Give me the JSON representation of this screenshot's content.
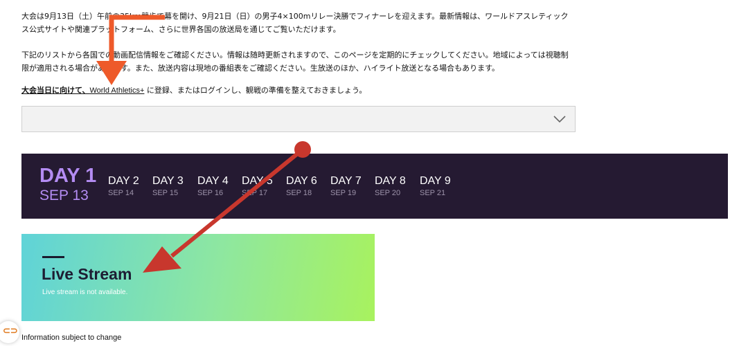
{
  "intro": {
    "p1": "大会は9月13日（土）午前の35km競歩で幕を開け、9月21日（日）の男子4×100mリレー決勝でフィナーレを迎えます。最新情報は、ワールドアスレティックス公式サイトや関連プラットフォーム、さらに世界各国の放送局を通じてご覧いただけます。",
    "p2": "下記のリストから各国での動画配信情報をご確認ください。情報は随時更新されますので、このページを定期的にチェックしてください。地域によっては視聴制限が適用される場合があります。また、放送内容は現地の番組表をご確認ください。生放送のほか、ハイライト放送となる場合もあります。",
    "p3_bold": "大会当日に向けて、",
    "p3_link": "World Athletics+",
    "p3_rest": " に登録、またはログインし、観戦の準備を整えておきましょう。"
  },
  "country_select": {
    "value": ""
  },
  "days": {
    "active": {
      "label": "DAY 1",
      "date": "SEP 13"
    },
    "items": [
      {
        "label": "DAY 2",
        "date": "SEP 14"
      },
      {
        "label": "DAY 3",
        "date": "SEP 15"
      },
      {
        "label": "DAY 4",
        "date": "SEP 16"
      },
      {
        "label": "DAY 5",
        "date": "SEP 17"
      },
      {
        "label": "DAY 6",
        "date": "SEP 18"
      },
      {
        "label": "DAY 7",
        "date": "SEP 19"
      },
      {
        "label": "DAY 8",
        "date": "SEP 20"
      },
      {
        "label": "DAY 9",
        "date": "SEP 21"
      }
    ]
  },
  "live_card": {
    "title": "Live Stream",
    "subtitle": "Live stream is not available."
  },
  "footer_note": "Information subject to change",
  "fab_icon": "link-icon",
  "colors": {
    "days_bg": "#251a32",
    "active_day": "#b48cf3",
    "annotation_orange": "#ee5a2a",
    "annotation_red": "#c8372d"
  }
}
